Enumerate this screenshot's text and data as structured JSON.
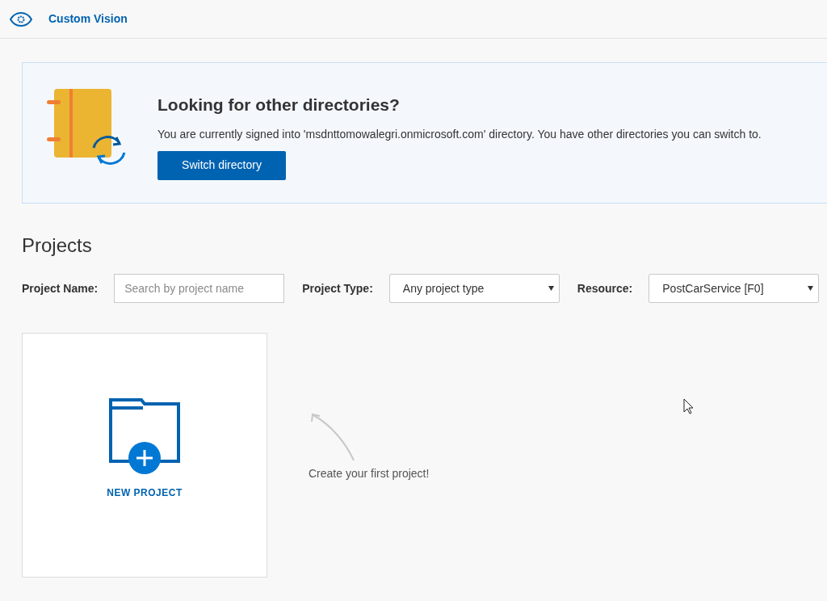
{
  "header": {
    "title": "Custom Vision"
  },
  "banner": {
    "heading": "Looking for other directories?",
    "message": "You are currently signed into 'msdnttomowalegri.onmicrosoft.com' directory. You have other directories you can switch to.",
    "button": "Switch directory"
  },
  "projects": {
    "heading": "Projects",
    "filters": [
      {
        "kind": "text",
        "label": "Project Name:",
        "placeholder": "Search by project name"
      },
      {
        "kind": "select",
        "label": "Project Type:",
        "value": "Any project type"
      },
      {
        "kind": "select",
        "label": "Resource:",
        "value": "PostCarService [F0]"
      }
    ],
    "new_project": "NEW PROJECT",
    "hint": "Create your first project!"
  }
}
